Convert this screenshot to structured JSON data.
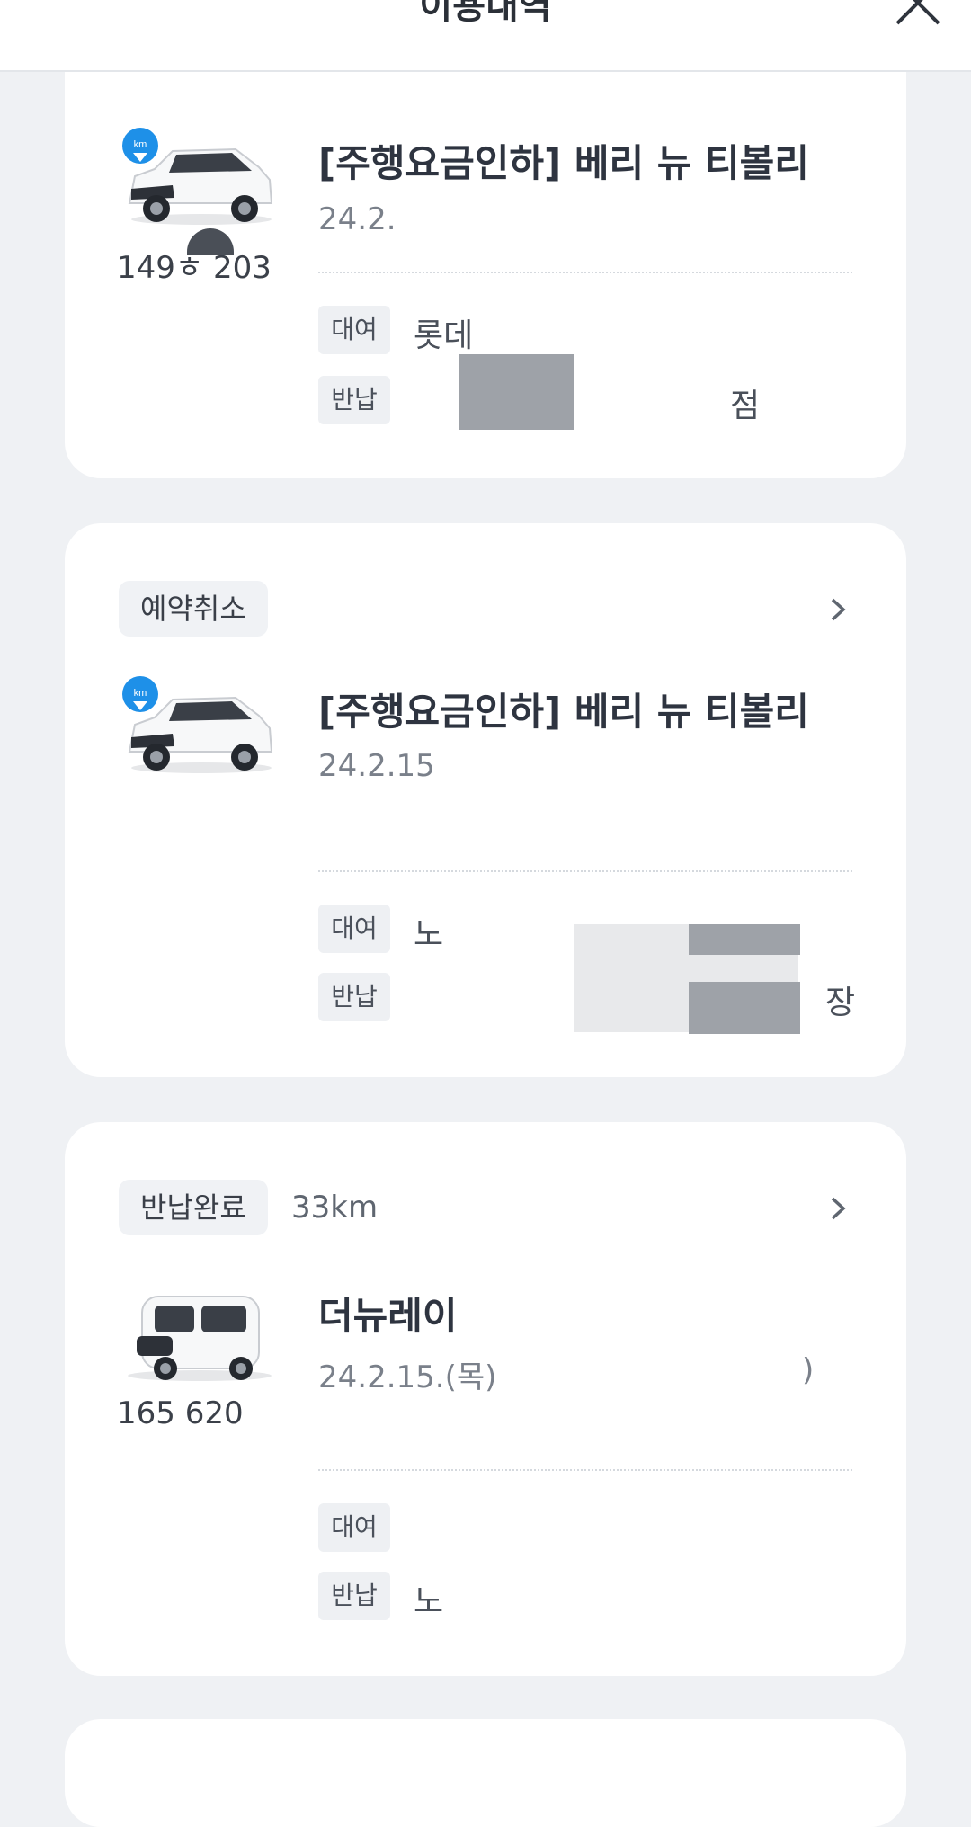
{
  "header": {
    "title": "이용내역"
  },
  "cards": [
    {
      "status": "",
      "car_name": "[주행요금인하] 베리 뉴 티볼리",
      "plate": "149ㅎ 203",
      "period": "24.2.",
      "rental_tag": "대여",
      "return_tag": "반납",
      "rental_loc": "롯데",
      "return_loc": "점"
    },
    {
      "status": "예약취소",
      "car_name": "[주행요금인하] 베리 뉴 티볼리",
      "plate": "",
      "period": "24.2.15",
      "rental_tag": "대여",
      "return_tag": "반납",
      "rental_loc": "노",
      "return_loc": "장"
    },
    {
      "status": "반납완료",
      "distance": "33km",
      "car_name": "더뉴레이",
      "plate": "165 620",
      "period": "24.2.15.(목)",
      "period_end": ")",
      "rental_tag": "대여",
      "return_tag": "반납",
      "rental_loc": "",
      "return_loc": "노"
    }
  ],
  "colors": {
    "background": "#eff1f4",
    "card": "#ffffff",
    "badge": "#f0f2f5",
    "km_badge": "#1e90e8"
  },
  "icons": [
    "close-icon",
    "chevron-right-icon",
    "km-badge-icon",
    "car-image"
  ]
}
